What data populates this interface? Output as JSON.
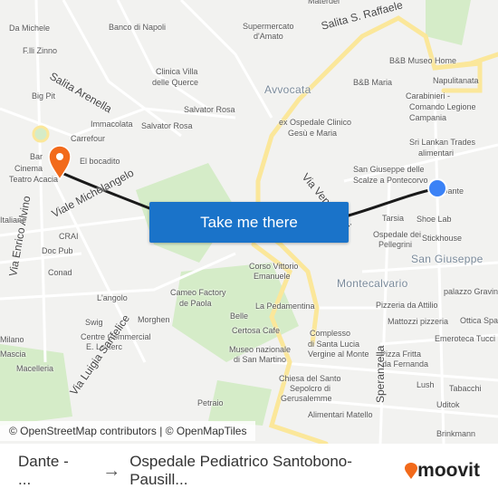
{
  "map": {
    "cta_label": "Take me there",
    "attribution": "© OpenStreetMap contributors | © OpenMapTiles",
    "route_color": "#1a1a1a",
    "origin_marker_color": "#f26a1b",
    "destination_marker_color": "#3b82f6",
    "labels": [
      "Materdei",
      "Salita S. Raffaele",
      "Banco di Napoli",
      "Supermercato",
      "d'Amato",
      "Da Michele",
      "F.lli Zinno",
      "Salita Arenella",
      "Big Pit",
      "Clinica Villa",
      "delle Querce",
      "Avvocata",
      "B&B Museo Home",
      "Napulitanata",
      "B&B Maria",
      "Immacolata",
      "Salvator Rosa",
      "Salvator Rosa",
      "Carrefour",
      "El bocadito",
      "Bar",
      "Cinema",
      "Teatro Acacia",
      "Viale Michelangelo",
      "ex Ospedale Clinico",
      "Gesù e Maria",
      "Carabinieri -",
      "Comando Legione",
      "Campania",
      "Sri Lankan Trades",
      "alimentari",
      "Via Ventaglieri",
      "San Giuseppe delle",
      "Scalze a Pontecorvo",
      "Tarsia",
      "Shoe Lab",
      "Ospedale dei",
      "Pellegrini",
      "Stickhouse",
      "San Giuseppe",
      "Montecalvario",
      "CRAI",
      "Doc Pub",
      "Conad",
      "L'angolo",
      "Swig",
      "Cameo Factory",
      "de Paola",
      "Corso Vittorio",
      "Emanuele",
      "Morghen",
      "Belle",
      "La Pedamentina",
      "Centre Commercial",
      "E. Leclerc",
      "Certosa Cafe",
      "Museo nazionale",
      "di San Martino",
      "Complesso",
      "di Santa Lucia",
      "Vergine al Monte",
      "Pizzeria da Attilio",
      "Mattozzi pizzeria",
      "palazzo Gravina",
      "Ottica Spa",
      "Emeroteca Tucci",
      "Pizza Fritta",
      "da Fernanda",
      "Chiesa del Santo",
      "Sepolcro di",
      "Gerusalemme",
      "Lush",
      "Tabacchi",
      "Uditok",
      "Alimentari Matello",
      "Petraio",
      "Via Luigia Sanfelice",
      "Via Enrico Alvino",
      "Macelleria",
      "Brinkmann",
      "Speranzella",
      "Italiane",
      "Milano",
      "Mascia",
      "Dante"
    ]
  },
  "footer": {
    "origin": "Dante - ...",
    "arrow_icon": "arrow-right-icon",
    "destination": "Ospedale Pediatrico Santobono-Pausill...",
    "brand": "moovit",
    "brand_color": "#f26a1b"
  }
}
